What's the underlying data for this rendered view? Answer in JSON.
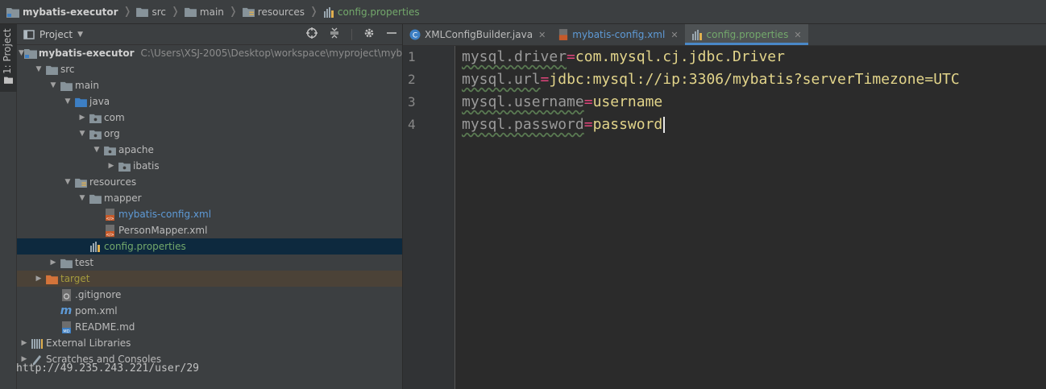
{
  "breadcrumb": [
    "mybatis-executor",
    "src",
    "main",
    "resources",
    "config.properties"
  ],
  "stripe": {
    "tab_label": "1: Project"
  },
  "project_panel": {
    "title": "Project",
    "tree": [
      {
        "label": "mybatis-executor",
        "path": "C:\\Users\\XSJ-2005\\Desktop\\workspace\\myproject\\myba"
      },
      {
        "label": "src"
      },
      {
        "label": "main"
      },
      {
        "label": "java"
      },
      {
        "label": "com"
      },
      {
        "label": "org"
      },
      {
        "label": "apache"
      },
      {
        "label": "ibatis"
      },
      {
        "label": "resources"
      },
      {
        "label": "mapper"
      },
      {
        "label": "mybatis-config.xml"
      },
      {
        "label": "PersonMapper.xml"
      },
      {
        "label": "config.properties"
      },
      {
        "label": "test"
      },
      {
        "label": "target"
      },
      {
        "label": ".gitignore"
      },
      {
        "label": "pom.xml"
      },
      {
        "label": "README.md"
      },
      {
        "label": "External Libraries"
      },
      {
        "label": "Scratches and Consoles"
      }
    ]
  },
  "watermark": "http://49.235.243.221/user/29",
  "editor": {
    "tabs": [
      {
        "label": "XMLConfigBuilder.java"
      },
      {
        "label": "mybatis-config.xml"
      },
      {
        "label": "config.properties"
      }
    ],
    "lines": [
      {
        "num": "1",
        "key": "mysql.driver",
        "eq": "=",
        "value": "com.mysql.cj.jdbc.Driver"
      },
      {
        "num": "2",
        "key": "mysql.url",
        "eq": "=",
        "value": "jdbc:mysql://ip:3306/mybatis?serverTimezone=UTC"
      },
      {
        "num": "3",
        "key": "mysql.username",
        "eq": "=",
        "value": "username"
      },
      {
        "num": "4",
        "key": "mysql.password",
        "eq": "=",
        "value": "password"
      }
    ]
  }
}
